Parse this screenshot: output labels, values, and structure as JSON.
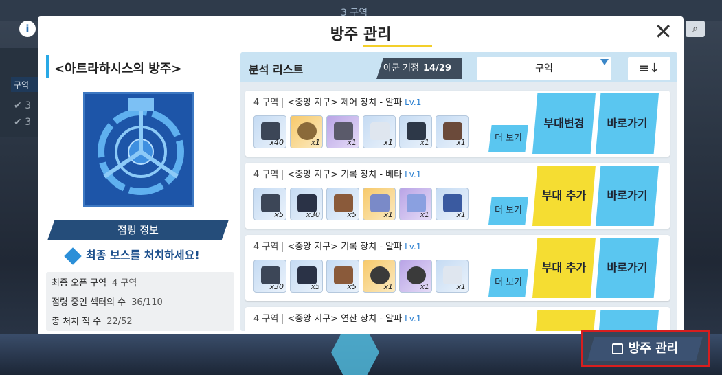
{
  "background": {
    "zone_label": "3 구역",
    "info_glyph": "i",
    "search_glyph": "⌕",
    "side_label": "구역 ",
    "side_values": [
      "3",
      "3"
    ]
  },
  "modal": {
    "title": "방주 관리",
    "close_glyph": "✕"
  },
  "left": {
    "heading": "<아트라하시스의 방주>",
    "occupy_label": "점령 정보",
    "mission": "최종 보스를 처치하세요!",
    "stats": [
      {
        "label": "최종 오픈 구역",
        "value": "4 구역"
      },
      {
        "label": "점령 중인 섹터의 수",
        "value": "36/110"
      },
      {
        "label": "총 처치 적 수",
        "value": "22/52"
      }
    ]
  },
  "right": {
    "list_title": "분석 리스트",
    "ally_label": "아군 거점",
    "ally_value": "14/29",
    "zone_filter": "구역",
    "sort_glyph": "≡↓",
    "items": [
      {
        "zone": "4 구역",
        "name": "<중앙 지구> 제어 장치 - 알파",
        "level": "Lv.1",
        "rewards": [
          "x40",
          "x1",
          "x1",
          "x1",
          "x1",
          "x1"
        ],
        "more": "더 보기",
        "action": "부대변경",
        "go": "바로가기"
      },
      {
        "zone": "4 구역",
        "name": "<중앙 지구> 기록 장치 - 베타",
        "level": "Lv.1",
        "rewards": [
          "x5",
          "x30",
          "x5",
          "x1",
          "x1",
          "x1"
        ],
        "more": "더 보기",
        "action": "부대 추가",
        "go": "바로가기"
      },
      {
        "zone": "4 구역",
        "name": "<중앙 지구> 기록 장치 - 알파",
        "level": "Lv.1",
        "rewards": [
          "x30",
          "x5",
          "x5",
          "x1",
          "x1",
          "x1"
        ],
        "more": "더 보기",
        "action": "부대 추가",
        "go": "바로가기"
      },
      {
        "zone": "4 구역",
        "name": "<중앙 지구> 연산 장치 - 알파",
        "level": "Lv.1"
      }
    ]
  },
  "bottom": {
    "manage_label": "방주 관리"
  }
}
